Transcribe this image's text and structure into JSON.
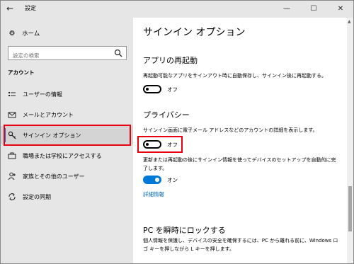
{
  "window": {
    "title": "設定"
  },
  "sidebar": {
    "home_label": "ホーム",
    "search_placeholder": "設定の検索",
    "section": "アカウント",
    "items": [
      {
        "label": "ユーザーの情報",
        "icon": "user-info-icon"
      },
      {
        "label": "メールとアカウント",
        "icon": "mail-icon"
      },
      {
        "label": "サインイン オプション",
        "icon": "key-icon",
        "selected": true
      },
      {
        "label": "職場または学校にアクセスする",
        "icon": "briefcase-icon"
      },
      {
        "label": "家族とその他のユーザー",
        "icon": "person-add-icon"
      },
      {
        "label": "設定の同期",
        "icon": "sync-icon"
      }
    ]
  },
  "main": {
    "title": "サインイン オプション",
    "restart": {
      "heading": "アプリの再起動",
      "description": "再起動可能なアプリをサインアウト時に自動保存し、サインイン後に再起動する。",
      "toggle_state": "オフ"
    },
    "privacy": {
      "heading": "プライバシー",
      "description1": "サインイン画面に電子メール アドレスなどのアカウントの詳細を表示します。",
      "toggle1_state": "オフ",
      "description2": "更新または再起動の後にサインイン情報を使ってデバイスのセットアップを自動的に完了します。",
      "toggle2_state": "オン",
      "link": "詳細情報"
    },
    "lock": {
      "heading": "PC を瞬時にロックする",
      "description": "個人情報を保護し、デバイスの安全を確保するには、PC から離れる前に、Windows ロ ゴ キーを押しながら L キーを押します。"
    }
  },
  "colors": {
    "accent": "#0078d7",
    "highlight": "#e60012",
    "sidebar_bg": "#e6e6e6",
    "link": "#0067b8"
  }
}
